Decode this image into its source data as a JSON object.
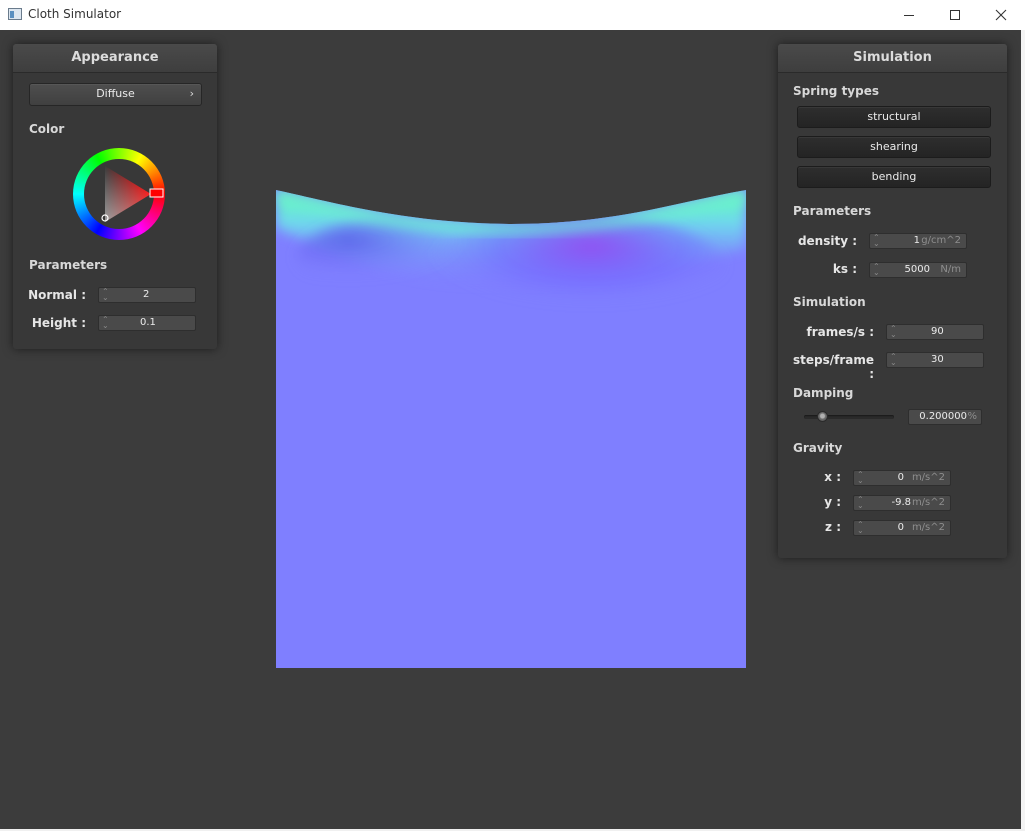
{
  "window": {
    "title": "Cloth Simulator",
    "icon": "app-window-icon",
    "controls": [
      "minimize-icon",
      "maximize-icon",
      "close-icon"
    ]
  },
  "appearance": {
    "title": "Appearance",
    "material": {
      "selected": "Diffuse",
      "chevron": "›"
    },
    "color_label": "Color",
    "color": {
      "selected_hue_hex": "#ff0000"
    },
    "parameters_label": "Parameters",
    "normal": {
      "label": "Normal :",
      "value": "2"
    },
    "height": {
      "label": "Height :",
      "value": "0.1"
    }
  },
  "simulation": {
    "title": "Simulation",
    "spring_types_label": "Spring types",
    "spring_types": [
      "structural",
      "shearing",
      "bending"
    ],
    "parameters_label": "Parameters",
    "density": {
      "label": "density :",
      "value": "1",
      "unit": "g/cm^2"
    },
    "ks": {
      "label": "ks :",
      "value": "5000",
      "unit": "N/m"
    },
    "simulation_label": "Simulation",
    "frames": {
      "label": "frames/s :",
      "value": "90"
    },
    "steps": {
      "label": "steps/frame :",
      "value": "30"
    },
    "damping_label": "Damping",
    "damping": {
      "value": "0.200000",
      "unit": "%",
      "slider_fraction": 0.2
    },
    "gravity_label": "Gravity",
    "gravity": {
      "x": {
        "label": "x :",
        "value": "0",
        "unit": "m/s^2"
      },
      "y": {
        "label": "y :",
        "value": "-9.8",
        "unit": "m/s^2"
      },
      "z": {
        "label": "z :",
        "value": "0",
        "unit": "m/s^2"
      }
    }
  },
  "colors": {
    "background": "#3c3c3c",
    "panel": "#383838",
    "cloth_base": "#7f7fff"
  }
}
